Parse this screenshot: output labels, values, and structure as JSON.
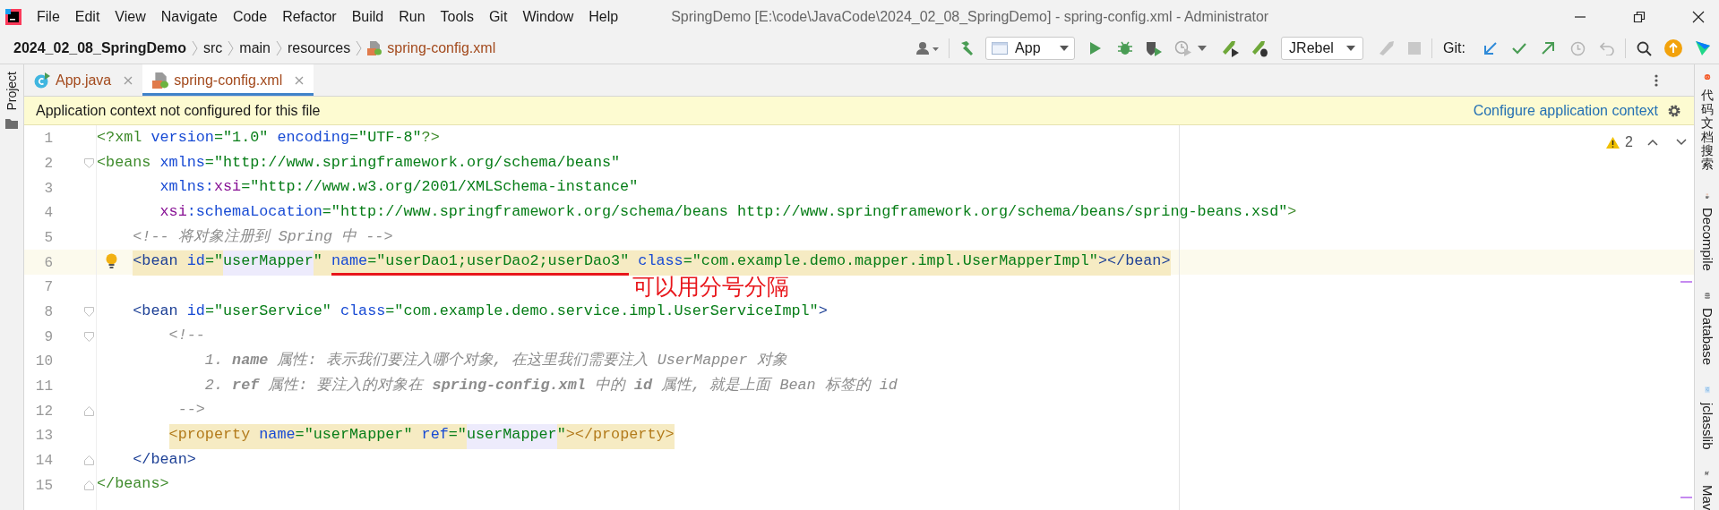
{
  "title_bar": {
    "menu": [
      "File",
      "Edit",
      "View",
      "Navigate",
      "Code",
      "Refactor",
      "Build",
      "Run",
      "Tools",
      "Git",
      "Window",
      "Help"
    ],
    "title": "SpringDemo [E:\\code\\JavaCode\\2024_02_08_SpringDemo] - spring-config.xml - Administrator"
  },
  "breadcrumbs": [
    {
      "label": "2024_02_08_SpringDemo",
      "kind": "project"
    },
    {
      "label": "src",
      "kind": "folder"
    },
    {
      "label": "main",
      "kind": "folder"
    },
    {
      "label": "resources",
      "kind": "folder"
    },
    {
      "label": "spring-config.xml",
      "kind": "file"
    }
  ],
  "toolbar": {
    "run_config": "App",
    "jrebel": "JRebel",
    "git_label": "Git:"
  },
  "left_panel": [
    "Project"
  ],
  "tabs": [
    {
      "label": "App.java",
      "kind": "java",
      "selected": false
    },
    {
      "label": "spring-config.xml",
      "kind": "xml",
      "selected": true
    }
  ],
  "notification": {
    "message": "Application context not configured for this file",
    "link": "Configure application context"
  },
  "inspections": {
    "warnings": "2"
  },
  "lines": [
    {
      "number": "1",
      "tokens": [
        {
          "text": "<?xml ",
          "kind": "tag1"
        },
        {
          "text": "version",
          "kind": "attr"
        },
        {
          "text": "=\"1.0\" ",
          "kind": "value"
        },
        {
          "text": "encoding",
          "kind": "attr"
        },
        {
          "text": "=\"UTF-8\"",
          "kind": "value"
        },
        {
          "text": "?>",
          "kind": "tag1"
        }
      ]
    },
    {
      "number": "2",
      "fold_start": true,
      "tokens": [
        {
          "text": "<beans ",
          "kind": "tag1"
        },
        {
          "text": "xmlns",
          "kind": "attr"
        },
        {
          "text": "=\"http://www.springframework.org/schema/beans\"",
          "kind": "value"
        }
      ]
    },
    {
      "number": "3",
      "tokens": [
        {
          "text": "       xmlns",
          "kind": "attr"
        },
        {
          "text": ":",
          "kind": "attr"
        },
        {
          "text": "xsi",
          "kind": "ns"
        },
        {
          "text": "=\"http://www.w3.org/2001/XMLSchema-instance\"",
          "kind": "value"
        }
      ]
    },
    {
      "number": "4",
      "tokens": [
        {
          "text": "       xsi",
          "kind": "ns"
        },
        {
          "text": ":schemaLocation",
          "kind": "attr"
        },
        {
          "text": "=\"http://www.springframework.org/schema/beans http://www.springframework.org/schema/beans/spring-beans.xsd\"",
          "kind": "value"
        },
        {
          "text": ">",
          "kind": "tag1"
        }
      ]
    },
    {
      "number": "5",
      "tokens": [
        {
          "text": "    <!-- 将对象注册到 Spring 中 -->",
          "kind": "comment"
        }
      ]
    },
    {
      "number": "6",
      "current": true,
      "intention": true,
      "tokens": [
        {
          "text": "    <bean ",
          "kind": "tag2",
          "matched_tag": true
        },
        {
          "text": "id",
          "kind": "attr",
          "matched_tag": true
        },
        {
          "text": "=\"",
          "kind": "value",
          "matched_tag": true
        },
        {
          "text": "userMapper",
          "kind": "value",
          "usage": true
        },
        {
          "text": "\" ",
          "kind": "value",
          "matched_tag": true
        },
        {
          "text": "name",
          "kind": "attr",
          "matched_tag": true,
          "underline": true
        },
        {
          "text": "=\"userDao1;userDao2;userDao3\"",
          "kind": "value",
          "matched_tag": true,
          "underline": true
        },
        {
          "text": " class",
          "kind": "attr",
          "matched_tag": true
        },
        {
          "text": "=\"com.example.demo.mapper.impl.UserMapperImpl\"",
          "kind": "value",
          "matched_tag": true
        },
        {
          "text": "></bean>",
          "kind": "tag2",
          "matched_tag": true
        }
      ]
    },
    {
      "number": "7",
      "note": "可以用分号分隔"
    },
    {
      "number": "8",
      "fold_start": true,
      "tokens": [
        {
          "text": "    <bean ",
          "kind": "tag2"
        },
        {
          "text": "id",
          "kind": "attr"
        },
        {
          "text": "=\"userService\" ",
          "kind": "value"
        },
        {
          "text": "class",
          "kind": "attr"
        },
        {
          "text": "=\"com.example.demo.service.impl.UserServiceImpl\"",
          "kind": "value"
        },
        {
          "text": ">",
          "kind": "tag2"
        }
      ]
    },
    {
      "number": "9",
      "fold_start": true,
      "tokens": [
        {
          "text": "        <!--",
          "kind": "comment"
        }
      ]
    },
    {
      "number": "10",
      "tokens": [
        {
          "text": "            1. **name** 属性: 表示我们要注入哪个对象, 在这里我们需要注入 UserMapper 对象",
          "kind": "comment"
        }
      ]
    },
    {
      "number": "11",
      "tokens": [
        {
          "text": "            2. **ref** 属性: 要注入的对象在 **spring-config.xml** 中的 **id** 属性, 就是上面 Bean 标签的 id",
          "kind": "comment"
        }
      ]
    },
    {
      "number": "12",
      "fold_end": true,
      "tokens": [
        {
          "text": "         -->",
          "kind": "comment"
        }
      ]
    },
    {
      "number": "13",
      "tokens": [
        {
          "text": "        <property ",
          "kind": "tag3",
          "matched_tag": true
        },
        {
          "text": "name",
          "kind": "attr",
          "matched_tag": true
        },
        {
          "text": "=\"userMapper\" ",
          "kind": "value",
          "matched_tag": true
        },
        {
          "text": "ref",
          "kind": "attr",
          "matched_tag": true
        },
        {
          "text": "=\"",
          "kind": "value",
          "matched_tag": true
        },
        {
          "text": "userMapper",
          "kind": "value",
          "usage": true
        },
        {
          "text": "\"",
          "kind": "value",
          "matched_tag": true
        },
        {
          "text": "></property>",
          "kind": "tag3",
          "matched_tag": true
        }
      ]
    },
    {
      "number": "14",
      "fold_end": true,
      "tokens": [
        {
          "text": "    </bean>",
          "kind": "tag2"
        }
      ]
    },
    {
      "number": "15",
      "fold_end": true,
      "tokens": [
        {
          "text": "</beans>",
          "kind": "tag1"
        }
      ]
    }
  ],
  "right_panel": [
    {
      "label": "代码文档搜索",
      "kind": "cjk"
    },
    {
      "label": "Decompile",
      "kind": "decompile"
    },
    {
      "label": "Database",
      "kind": "database"
    },
    {
      "label": "jclasslib",
      "kind": "jclasslib"
    },
    {
      "label": "Mav",
      "kind": "maven"
    }
  ]
}
